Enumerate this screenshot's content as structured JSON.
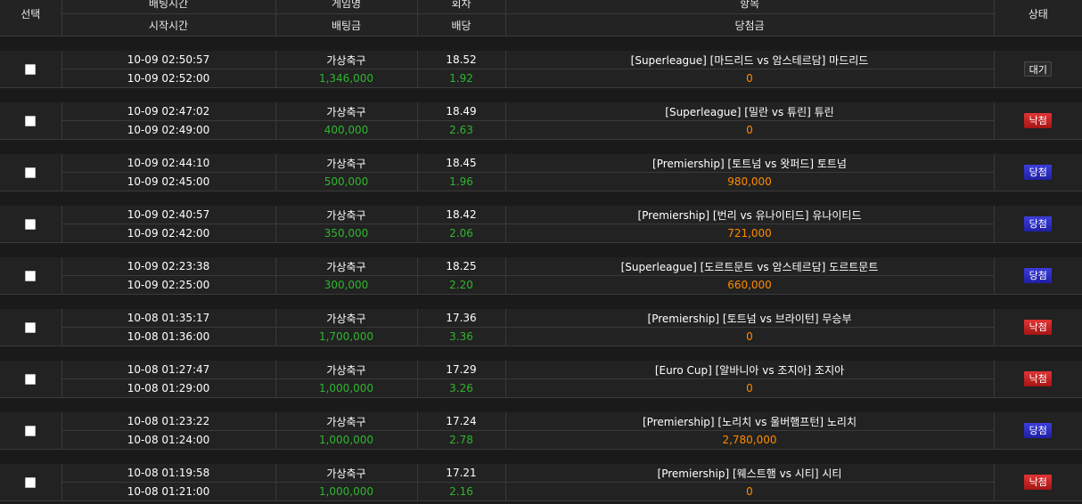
{
  "header": {
    "select": "선택",
    "bet_time": "배팅시간",
    "start_time": "시작시간",
    "game_name": "게임명",
    "bet_amount": "배팅금",
    "round": "회차",
    "odds": "배당",
    "item": "항목",
    "win_amount": "당첨금",
    "status": "상태"
  },
  "colors": {
    "win_amount_zero": "#ff8a00",
    "bet_amount": "#2fb52f",
    "odds": "#2fb52f",
    "status_win": "#2a2ac8",
    "status_lose": "#c82222",
    "status_wait": "#2b2b2b"
  },
  "bets": [
    {
      "bet_time": "10-09 02:50:57",
      "start_time": "10-09 02:52:00",
      "game": "가상축구",
      "bet_amount": "1,346,000",
      "round": "18.52",
      "odds": "1.92",
      "item": "[Superleague] [마드리드 vs 암스테르담] 마드리드",
      "win_amount": "0",
      "status": "대기",
      "status_kind": "wait"
    },
    {
      "bet_time": "10-09 02:47:02",
      "start_time": "10-09 02:49:00",
      "game": "가상축구",
      "bet_amount": "400,000",
      "round": "18.49",
      "odds": "2.63",
      "item": "[Superleague] [밀란 vs 튜린] 튜린",
      "win_amount": "0",
      "status": "낙첨",
      "status_kind": "lose"
    },
    {
      "bet_time": "10-09 02:44:10",
      "start_time": "10-09 02:45:00",
      "game": "가상축구",
      "bet_amount": "500,000",
      "round": "18.45",
      "odds": "1.96",
      "item": "[Premiership] [토트넘 vs 왓퍼드] 토트넘",
      "win_amount": "980,000",
      "status": "당첨",
      "status_kind": "win"
    },
    {
      "bet_time": "10-09 02:40:57",
      "start_time": "10-09 02:42:00",
      "game": "가상축구",
      "bet_amount": "350,000",
      "round": "18.42",
      "odds": "2.06",
      "item": "[Premiership] [번리 vs 유나이티드] 유나이티드",
      "win_amount": "721,000",
      "status": "당첨",
      "status_kind": "win"
    },
    {
      "bet_time": "10-09 02:23:38",
      "start_time": "10-09 02:25:00",
      "game": "가상축구",
      "bet_amount": "300,000",
      "round": "18.25",
      "odds": "2.20",
      "item": "[Superleague] [도르트문트 vs 암스테르담] 도르트문트",
      "win_amount": "660,000",
      "status": "당첨",
      "status_kind": "win"
    },
    {
      "bet_time": "10-08 01:35:17",
      "start_time": "10-08 01:36:00",
      "game": "가상축구",
      "bet_amount": "1,700,000",
      "round": "17.36",
      "odds": "3.36",
      "item": "[Premiership] [토트넘 vs 브라이턴] 무승부",
      "win_amount": "0",
      "status": "낙첨",
      "status_kind": "lose"
    },
    {
      "bet_time": "10-08 01:27:47",
      "start_time": "10-08 01:29:00",
      "game": "가상축구",
      "bet_amount": "1,000,000",
      "round": "17.29",
      "odds": "3.26",
      "item": "[Euro Cup] [알바니아 vs 조지아] 조지아",
      "win_amount": "0",
      "status": "낙첨",
      "status_kind": "lose"
    },
    {
      "bet_time": "10-08 01:23:22",
      "start_time": "10-08 01:24:00",
      "game": "가상축구",
      "bet_amount": "1,000,000",
      "round": "17.24",
      "odds": "2.78",
      "item": "[Premiership] [노리치 vs 울버햄프턴] 노리치",
      "win_amount": "2,780,000",
      "status": "당첨",
      "status_kind": "win"
    },
    {
      "bet_time": "10-08 01:19:58",
      "start_time": "10-08 01:21:00",
      "game": "가상축구",
      "bet_amount": "1,000,000",
      "round": "17.21",
      "odds": "2.16",
      "item": "[Premiership] [웨스트햄 vs 시티] 시티",
      "win_amount": "0",
      "status": "낙첨",
      "status_kind": "lose"
    }
  ]
}
